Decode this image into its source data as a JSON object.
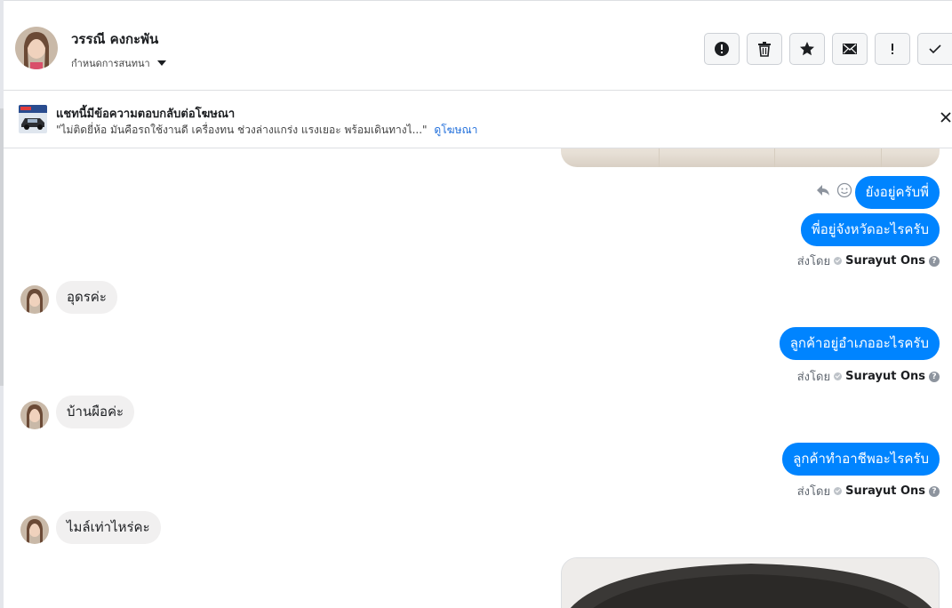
{
  "header": {
    "contact_name": "วรรณี คงกะพัน",
    "convo_settings_label": "กำหนดการสนทนา",
    "actions": [
      {
        "name": "mark-spam-button",
        "icon": "exclamation-circle-icon"
      },
      {
        "name": "delete-button",
        "icon": "trash-icon"
      },
      {
        "name": "star-button",
        "icon": "star-icon"
      },
      {
        "name": "mark-unread-button",
        "icon": "envelope-icon"
      },
      {
        "name": "follow-up-button",
        "icon": "exclamation-icon"
      },
      {
        "name": "mark-done-button",
        "icon": "check-icon"
      }
    ]
  },
  "ad_banner": {
    "title": "แชทนี้มีข้อความตอบกลับต่อโฆษณา",
    "snippet": "\"ไม่ติดยี่ห้อ มันคือรถใช้งานดี เครื่องทน ช่วงล่างแกร่ง แรงเยอะ พร้อมเดินทางไ...\"",
    "link_label": "ดูโฆษณา"
  },
  "messages": {
    "out_1": "ยังอยู่ครับพี่",
    "out_2": "พี่อยู่จังหวัดอะไรครับ",
    "in_1": "อุดรค่ะ",
    "out_3": "ลูกค้าอยู่อำเภออะไรครับ",
    "in_2": "บ้านผือค่ะ",
    "out_4": "ลูกค้าทำอาชีพอะไรครับ",
    "in_3": "ไมล์เท่าไหร่คะ"
  },
  "sent_by": {
    "prefix": "ส่งโดย",
    "agent_name": "Surayut Ons",
    "help_glyph": "?"
  },
  "colors": {
    "outgoing_bubble": "#0084ff",
    "incoming_bubble": "#f1f0f0",
    "link": "#216fdb"
  }
}
